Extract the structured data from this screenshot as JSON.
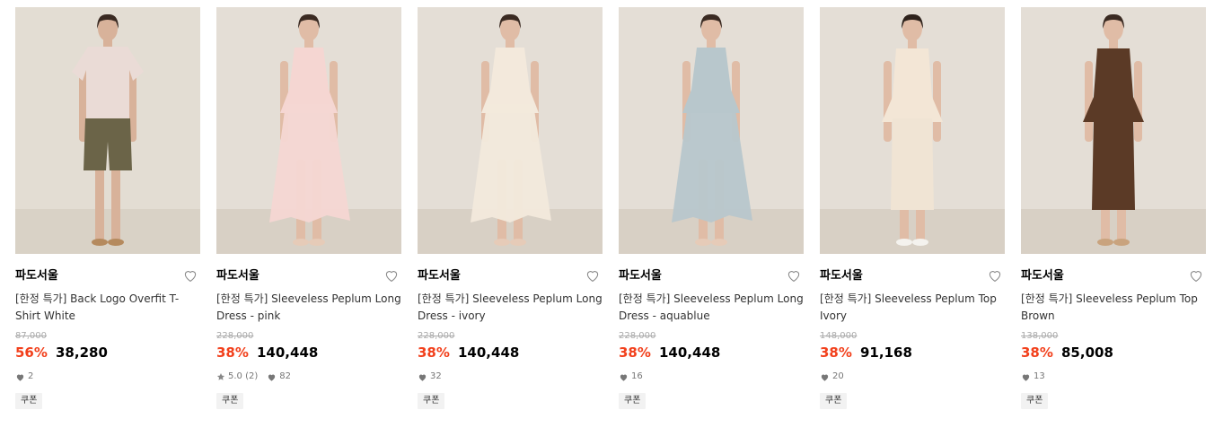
{
  "products": [
    {
      "brand": "파도서울",
      "title": "[한정 특가] Back Logo Overfit T-Shirt White",
      "original_price": "87,000",
      "discount": "56%",
      "price": "38,280",
      "rating": "",
      "likes": "2",
      "coupon": "쿠폰",
      "figure": "tee-shorts",
      "colors": {
        "bg": "#e3ddd3",
        "floor": "#d9d2c6",
        "top": "#eadbd6",
        "bottom": "#6b6448",
        "skin": "#d8b29a",
        "hair": "#3a2a22",
        "shoes": "#b58a5e"
      }
    },
    {
      "brand": "파도서울",
      "title": "[한정 특가] Sleeveless Peplum Long Dress - pink",
      "original_price": "228,000",
      "discount": "38%",
      "price": "140,448",
      "rating": "5.0 (2)",
      "likes": "82",
      "coupon": "쿠폰",
      "figure": "dress",
      "colors": {
        "bg": "#e4ded6",
        "floor": "#d8d0c5",
        "top": "#f5d6d2",
        "bottom": "#f5d6d2",
        "skin": "#e0bca6",
        "hair": "#3a2a22",
        "shoes": "#e6cbb8"
      }
    },
    {
      "brand": "파도서울",
      "title": "[한정 특가] Sleeveless Peplum Long Dress - ivory",
      "original_price": "228,000",
      "discount": "38%",
      "price": "140,448",
      "rating": "",
      "likes": "32",
      "coupon": "쿠폰",
      "figure": "dress",
      "colors": {
        "bg": "#e4ded6",
        "floor": "#d8d0c5",
        "top": "#f3e9dc",
        "bottom": "#f3e9dc",
        "skin": "#e0bca6",
        "hair": "#3a2a22",
        "shoes": "#e6cbb8"
      }
    },
    {
      "brand": "파도서울",
      "title": "[한정 특가] Sleeveless Peplum Long Dress - aquablue",
      "original_price": "228,000",
      "discount": "38%",
      "price": "140,448",
      "rating": "",
      "likes": "16",
      "coupon": "쿠폰",
      "figure": "dress",
      "colors": {
        "bg": "#e4ded6",
        "floor": "#d8d0c5",
        "top": "#b8c7cc",
        "bottom": "#b8c7cc",
        "skin": "#e0bca6",
        "hair": "#3a2a22",
        "shoes": "#e6cbb8"
      }
    },
    {
      "brand": "파도서울",
      "title": "[한정 특가] Sleeveless Peplum Top Ivory",
      "original_price": "148,000",
      "discount": "38%",
      "price": "91,168",
      "rating": "",
      "likes": "20",
      "coupon": "쿠폰",
      "figure": "top-skirt",
      "colors": {
        "bg": "#e4ded6",
        "floor": "#d8d0c5",
        "top": "#f3e6d6",
        "bottom": "#f0e4d4",
        "skin": "#e0bca6",
        "hair": "#2e221c",
        "shoes": "#f4f2ee"
      }
    },
    {
      "brand": "파도서울",
      "title": "[한정 특가] Sleeveless Peplum Top Brown",
      "original_price": "138,000",
      "discount": "38%",
      "price": "85,008",
      "rating": "",
      "likes": "13",
      "coupon": "쿠폰",
      "figure": "top-skirt-dark",
      "colors": {
        "bg": "#e4ded6",
        "floor": "#d8d0c5",
        "top": "#5b3a26",
        "bottom": "#5b3a26",
        "skin": "#e0bca6",
        "hair": "#3a2a22",
        "shoes": "#c9a37e"
      }
    }
  ],
  "icons": {
    "wishlist": "heart-outline-icon",
    "like": "heart-icon",
    "rating": "star-icon"
  },
  "colors": {
    "discount": "#f2401c",
    "text": "#111111",
    "muted": "#777777",
    "strike": "#aaaaaa"
  }
}
